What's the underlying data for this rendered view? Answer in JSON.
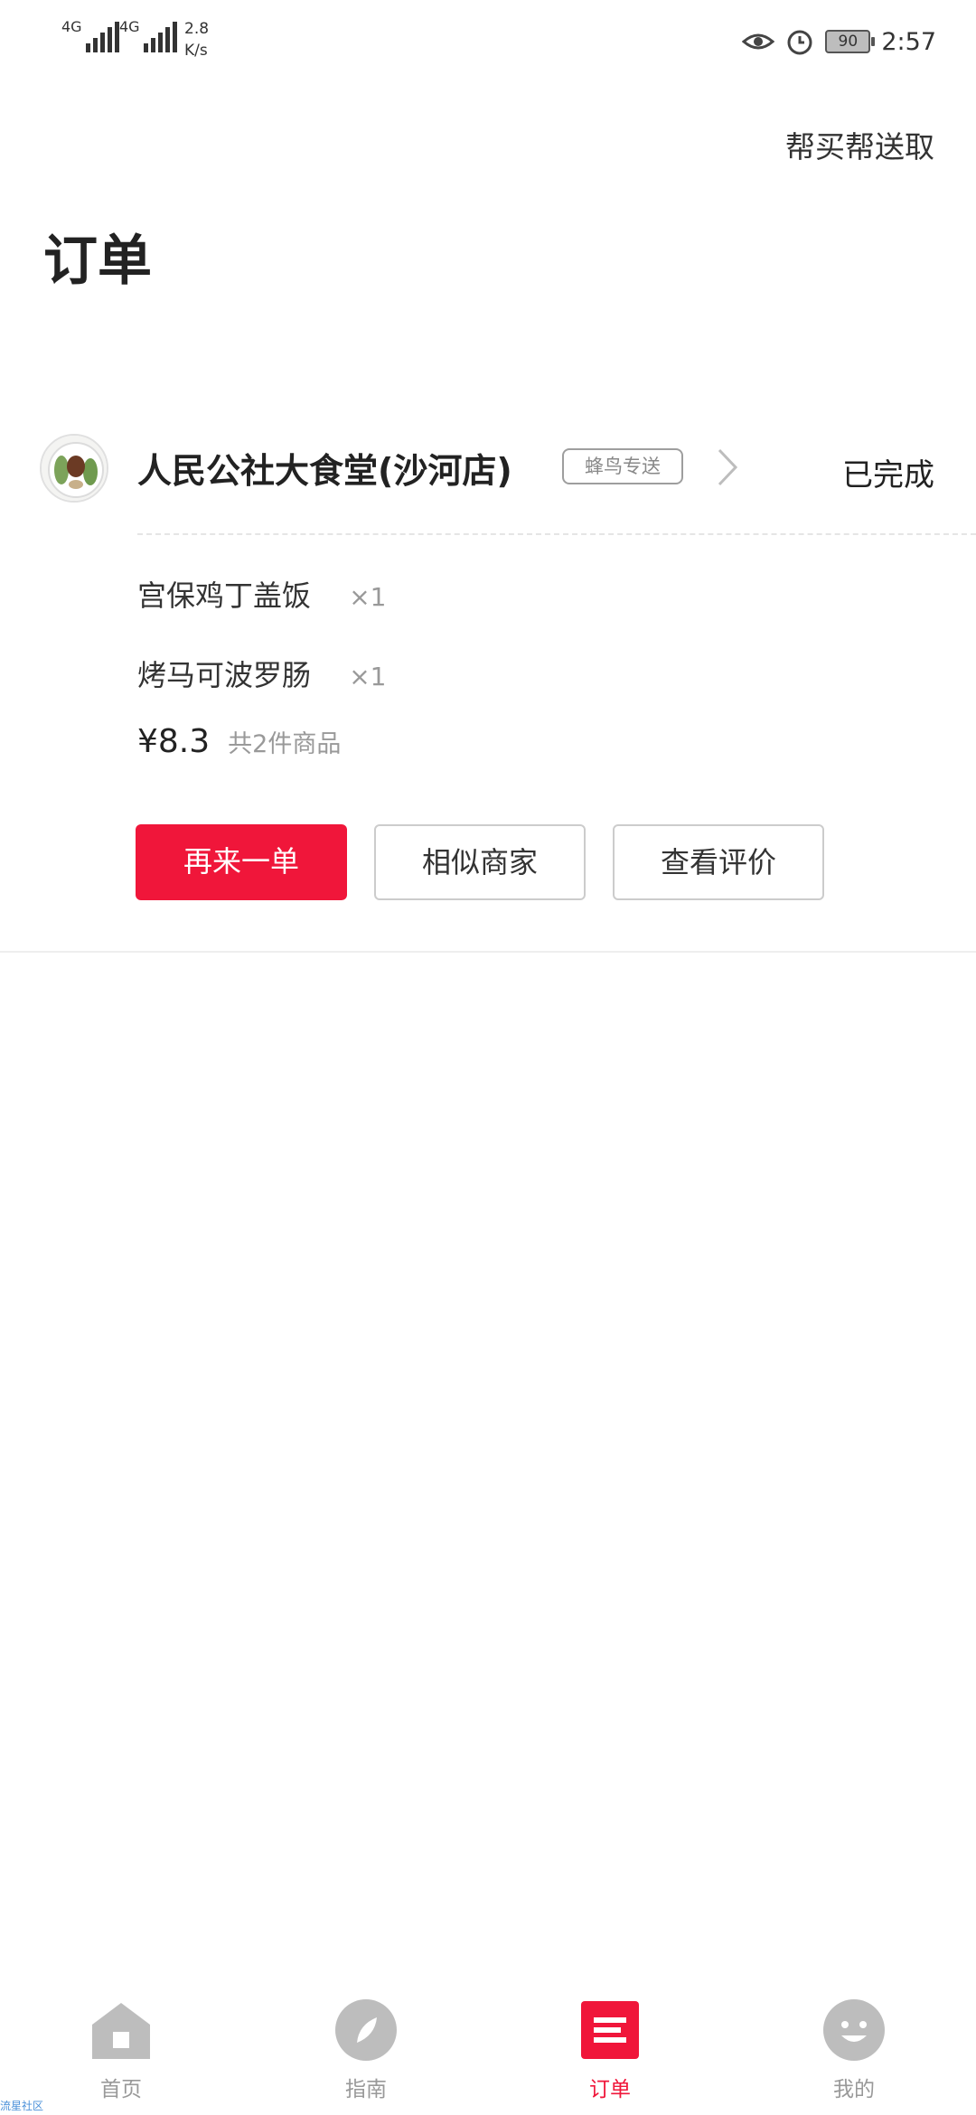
{
  "status_bar": {
    "sim1_label": "4G",
    "sim2_label": "4G",
    "net_speed_value": "2.8",
    "net_speed_unit": "K/s",
    "battery": "90",
    "time": "2:57"
  },
  "header": {
    "top_link": "帮买帮送取",
    "title": "订单"
  },
  "order": {
    "store_name": "人民公社大食堂(沙河店)",
    "delivery_badge": "蜂鸟专送",
    "status": "已完成",
    "items": [
      {
        "name": "宫保鸡丁盖饭",
        "qty": "×1"
      },
      {
        "name": "烤马可波罗肠",
        "qty": "×1"
      }
    ],
    "price": "¥8.3",
    "count_text": "共2件商品",
    "buttons": {
      "reorder": "再来一单",
      "similar": "相似商家",
      "review": "查看评价"
    }
  },
  "bottom_nav": {
    "items": [
      {
        "label": "首页",
        "icon": "home-icon"
      },
      {
        "label": "指南",
        "icon": "compass-icon"
      },
      {
        "label": "订单",
        "icon": "order-icon"
      },
      {
        "label": "我的",
        "icon": "smiley-icon"
      }
    ],
    "active_color": "#f0163a",
    "inactive_color": "#bdbdbd"
  },
  "watermark": "流星社区"
}
